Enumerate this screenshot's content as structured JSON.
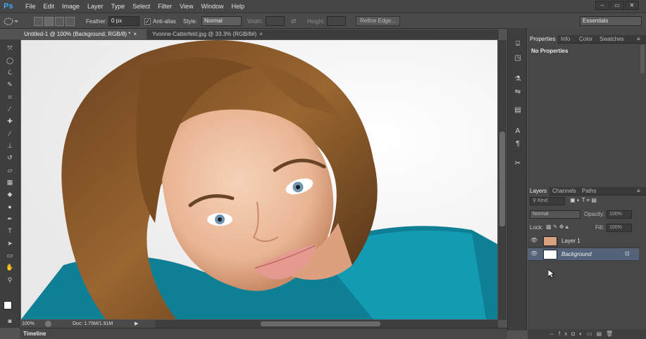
{
  "app": {
    "logo": "Ps"
  },
  "menu": [
    "File",
    "Edit",
    "Image",
    "Layer",
    "Type",
    "Select",
    "Filter",
    "View",
    "Window",
    "Help"
  ],
  "window_controls": [
    "–",
    "▭",
    "✕"
  ],
  "options": {
    "feather_label": "Feather:",
    "feather_value": "0 px",
    "antialias_label": "Anti-alias",
    "style_label": "Style:",
    "style_value": "Normal",
    "width_label": "Width:",
    "height_label": "Height:",
    "refine_edge": "Refine Edge...",
    "workspace": "Essentials"
  },
  "tabs": [
    {
      "label": "Untitled-1 @ 100% (Background, RGB/8) *"
    },
    {
      "label": "Yvonne-Catterfeld.jpg @ 33.3% (RGB/8#)"
    }
  ],
  "status": {
    "zoom": "100%",
    "doc": "Doc: 1.75M/1.91M"
  },
  "timeline": {
    "label": "Timeline"
  },
  "properties": {
    "tabs": [
      "Properties",
      "Info",
      "Color",
      "Swatches"
    ],
    "content": "No Properties"
  },
  "layers_panel": {
    "tabs": [
      "Layers",
      "Channels",
      "Paths"
    ],
    "kind": "Kind",
    "blend_mode": "Normal",
    "opacity_label": "Opacity:",
    "opacity_value": "100%",
    "lock_label": "Lock:",
    "fill_label": "Fill:",
    "fill_value": "100%",
    "layers": [
      {
        "name": "Layer 1",
        "selected": false
      },
      {
        "name": "Background",
        "selected": true
      }
    ]
  },
  "colors": {
    "accent": "#3ea9f5",
    "selected_layer": "#53647a"
  }
}
